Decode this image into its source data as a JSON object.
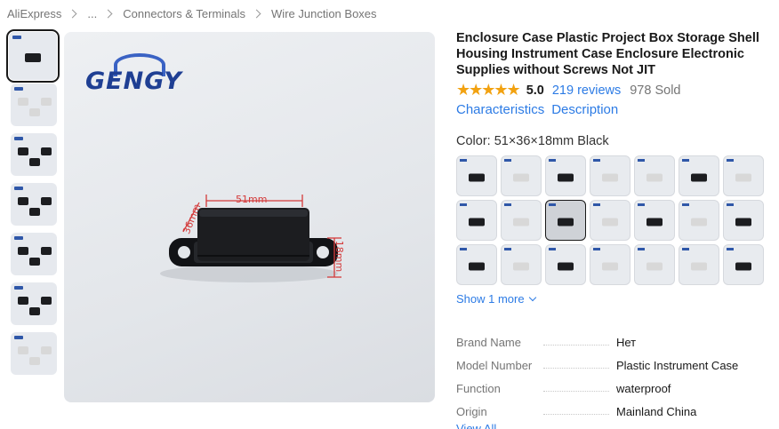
{
  "breadcrumb": {
    "items": [
      "AliExpress",
      "...",
      "Connectors & Terminals",
      "Wire Junction Boxes"
    ]
  },
  "gallery": {
    "logo_text": "GENGY",
    "dimension_labels": [
      "51mm",
      "36mm",
      "18mm"
    ],
    "thumbnail_count": 7,
    "active_thumbnail": 1
  },
  "product": {
    "title": "Enclosure Case Plastic Project Box Storage Shell Housing Instrument Case Enclosure Electronic Supplies without Screws Not JIT",
    "stars": "★★★★★",
    "rating": "5.0",
    "reviews": "219 reviews",
    "sold": "978 Sold"
  },
  "tabs": [
    "Characteristics",
    "Description"
  ],
  "variant": {
    "label": "Color: 51×36×18mm Black",
    "swatch_count": 21,
    "selected_index": 9,
    "show_more": "Show 1 more"
  },
  "specs": {
    "rows": [
      {
        "key": "Brand Name",
        "value": "Нет"
      },
      {
        "key": "Model Number",
        "value": "Plastic Instrument Case"
      },
      {
        "key": "Function",
        "value": "waterproof"
      },
      {
        "key": "Origin",
        "value": "Mainland China"
      }
    ],
    "view_all": "View All"
  },
  "colors": {
    "link": "#2c7be5",
    "star": "#f2a211",
    "text": "#191919",
    "muted": "#757575",
    "box_dark": "#1c1d20",
    "box_light": "#d8d8d8"
  }
}
